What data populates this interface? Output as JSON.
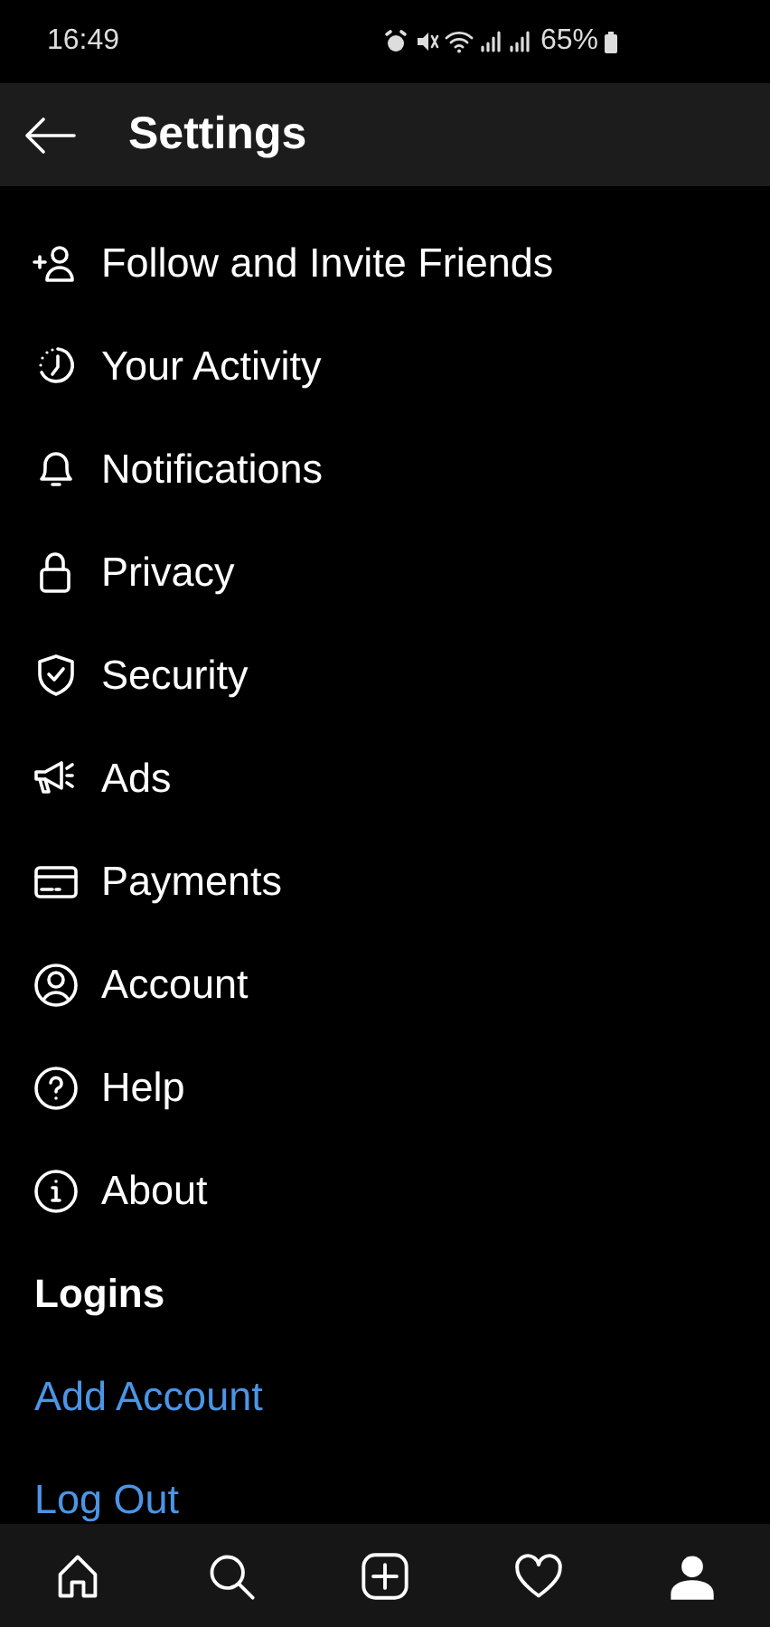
{
  "status_bar": {
    "time": "16:49",
    "battery": "65%"
  },
  "header": {
    "title": "Settings"
  },
  "items": [
    {
      "kind": "follow",
      "label": "Follow and Invite Friends"
    },
    {
      "kind": "activity",
      "label": "Your Activity"
    },
    {
      "kind": "bell",
      "label": "Notifications"
    },
    {
      "kind": "lock",
      "label": "Privacy"
    },
    {
      "kind": "shield",
      "label": "Security"
    },
    {
      "kind": "megaphone",
      "label": "Ads"
    },
    {
      "kind": "card",
      "label": "Payments"
    },
    {
      "kind": "account",
      "label": "Account"
    },
    {
      "kind": "help",
      "label": "Help"
    },
    {
      "kind": "info",
      "label": "About"
    }
  ],
  "logins": {
    "heading": "Logins",
    "links": [
      "Add Account",
      "Log Out"
    ]
  },
  "bottom_nav": [
    {
      "kind": "home",
      "selected": false
    },
    {
      "kind": "search",
      "selected": false
    },
    {
      "kind": "add",
      "selected": false
    },
    {
      "kind": "heart",
      "selected": false
    },
    {
      "kind": "profile",
      "selected": true
    }
  ]
}
